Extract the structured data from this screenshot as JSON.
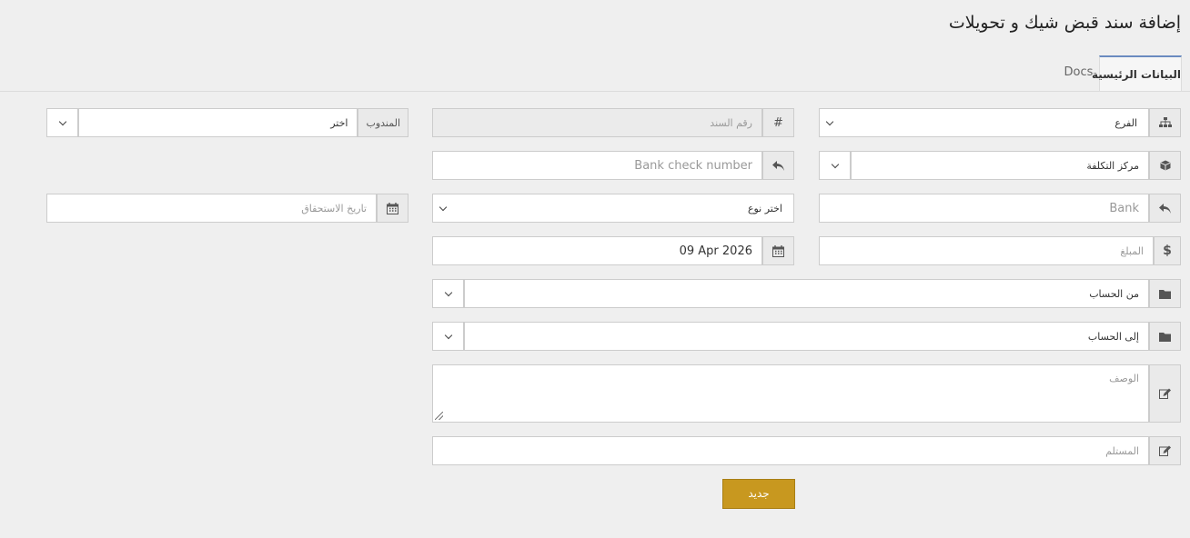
{
  "page": {
    "title": "إضافة سند قبض شيك و تحويلات"
  },
  "tabs": {
    "main": "البيانات الرئيسية",
    "docs": "Docs"
  },
  "form": {
    "branch": {
      "value": "الفرع",
      "icon": "sitemap-icon"
    },
    "voucher_no": {
      "prefix": "#",
      "placeholder": "رقم السند"
    },
    "delegate": {
      "label": "المندوب",
      "value": "اختر"
    },
    "cost_center": {
      "value": "مركز التكلفة",
      "icon": "cube-icon"
    },
    "bank_check_number": {
      "placeholder": "Bank check number",
      "icon": "reply-icon"
    },
    "bank": {
      "placeholder": "Bank",
      "icon": "reply-icon"
    },
    "type": {
      "value": "اختر نوع"
    },
    "due_date": {
      "placeholder": "تاريخ الاستحقاق",
      "icon": "calendar-icon"
    },
    "amount": {
      "placeholder": "المبلغ",
      "icon": "dollar-icon"
    },
    "date": {
      "value": "09 Apr 2026",
      "icon": "calendar-icon"
    },
    "from_account": {
      "value": "من الحساب",
      "icon": "folder-icon"
    },
    "to_account": {
      "value": "إلى الحساب",
      "icon": "folder-icon"
    },
    "description": {
      "placeholder": "الوصف",
      "icon": "edit-icon"
    },
    "recipient": {
      "placeholder": "المستلم",
      "icon": "edit-icon"
    }
  },
  "actions": {
    "new_label": "جديد"
  },
  "colors": {
    "accent": "#c8981f",
    "tab_border": "#6a8bc0"
  }
}
